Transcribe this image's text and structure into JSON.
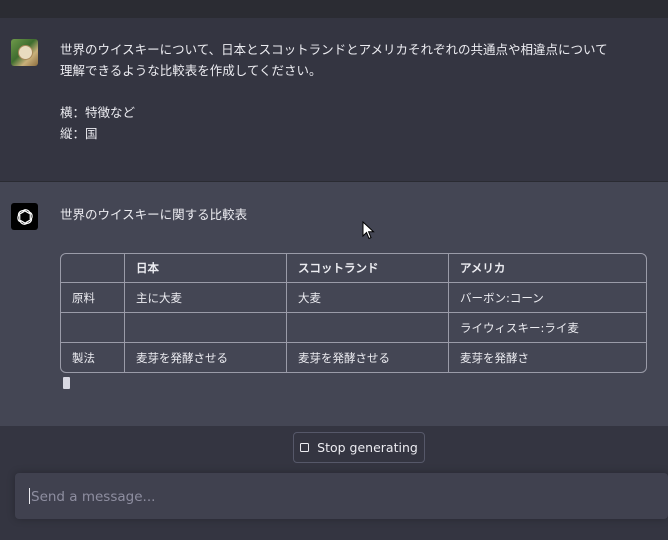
{
  "user_message": {
    "text": "世界のウイスキーについて、日本とスコットランドとアメリカそれぞれの共通点や相違点について\n理解できるような比較表を作成してください。\n\n横：特徴など\n縦：国"
  },
  "assistant_message": {
    "heading": "世界のウイスキーに関する比較表",
    "table": {
      "headers": [
        "",
        "日本",
        "スコットランド",
        "アメリカ"
      ],
      "rows": [
        [
          "原料",
          "主に大麦",
          "大麦",
          "バーボン:コーン"
        ],
        [
          "",
          "",
          "",
          "ライウィスキー:ライ麦"
        ],
        [
          "製法",
          "麦芽を発酵させる",
          "麦芽を発酵させる",
          "麦芽を発酵さ"
        ]
      ]
    }
  },
  "controls": {
    "stop_label": "Stop generating",
    "input_placeholder": "Send a message..."
  },
  "colors": {
    "background": "#343541",
    "assistant_background": "#444654",
    "input_background": "#40414f",
    "bot_avatar": "#000000"
  },
  "icons": {
    "user_avatar": "user-avatar-image",
    "bot_avatar": "openai-logo-icon",
    "stop": "stop-square-icon",
    "pointer": "mouse-pointer-icon"
  }
}
